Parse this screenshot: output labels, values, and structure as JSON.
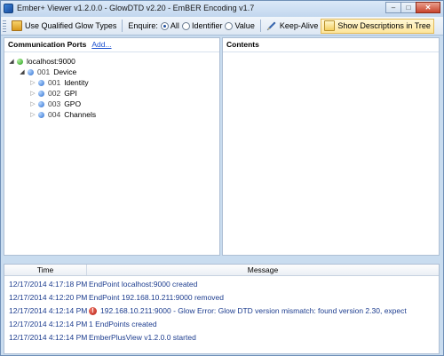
{
  "window": {
    "title": "Ember+ Viewer v1.2.0.0 - GlowDTD v2.20 - EmBER Encoding v1.7",
    "controls": {
      "minimize": "–",
      "maximize": "□",
      "close": "✕"
    }
  },
  "toolbar": {
    "use_qualified": "Use Qualified Glow Types",
    "enquire_label": "Enquire:",
    "enquire_options": [
      "All",
      "Identifier",
      "Value"
    ],
    "enquire_selected": "All",
    "keep_alive": "Keep-Alive",
    "show_desc": "Show Descriptions in Tree"
  },
  "left_pane": {
    "title": "Communication Ports",
    "add_link": "Add..."
  },
  "tree": [
    {
      "label": "localhost:9000",
      "num": "",
      "state": "expanded",
      "status": "green"
    },
    {
      "label": "Device",
      "num": "001",
      "state": "expanded",
      "status": "blue"
    },
    {
      "label": "Identity",
      "num": "001",
      "state": "collapsed",
      "status": "blue"
    },
    {
      "label": "GPI",
      "num": "002",
      "state": "collapsed",
      "status": "blue"
    },
    {
      "label": "GPO",
      "num": "003",
      "state": "collapsed",
      "status": "blue"
    },
    {
      "label": "Channels",
      "num": "004",
      "state": "collapsed",
      "status": "blue"
    }
  ],
  "right_pane": {
    "title": "Contents"
  },
  "log": {
    "columns": [
      "Time",
      "Message"
    ],
    "rows": [
      {
        "time": "12/17/2014 4:17:18 PM",
        "message": "EndPoint localhost:9000 created",
        "error": false
      },
      {
        "time": "12/17/2014 4:12:20 PM",
        "message": "EndPoint 192.168.10.211:9000 removed",
        "error": false
      },
      {
        "time": "12/17/2014 4:12:14 PM",
        "message": "192.168.10.211:9000 - Glow Error: Glow DTD version mismatch: found version 2.30, expect",
        "error": true
      },
      {
        "time": "12/17/2014 4:12:14 PM",
        "message": "1 EndPoints created",
        "error": false
      },
      {
        "time": "12/17/2014 4:12:14 PM",
        "message": "EmberPlusView v1.2.0.0 started",
        "error": false
      }
    ]
  }
}
